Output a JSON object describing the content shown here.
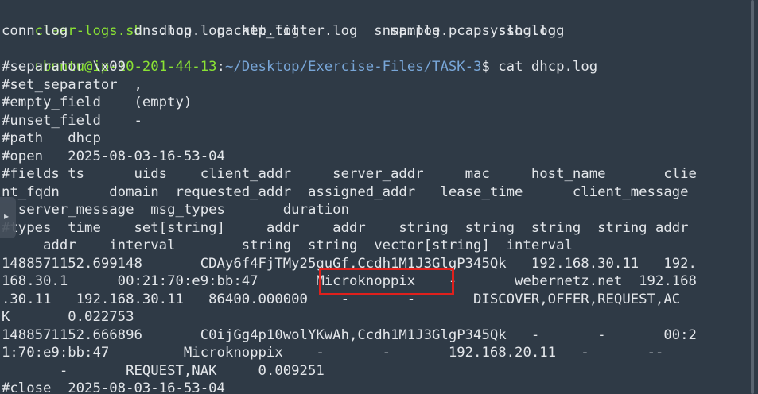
{
  "terminal": {
    "top_partial": "  ",
    "ls_row1": {
      "script": "clear-logs.sh",
      "rest": "  dhcp.log  ntp.log           sample.pcap  ssh.log"
    },
    "ls_row2": "conn.log        dns.log   packet_filter.log  snmp.log     syslog.log",
    "prompt": {
      "user_host": "ubuntu@ip-10-201-44-13",
      "colon": ":",
      "path": "~/Desktop/Exercise-Files/TASK-3",
      "symbol": "$",
      "command": " cat dhcp.log"
    },
    "output_lines": [
      "#separator \\x09",
      "#set_separator  ,",
      "#empty_field    (empty)",
      "#unset_field    -",
      "#path   dhcp",
      "#open   2025-08-03-16-53-04",
      "#fields ts      uids    client_addr     server_addr     mac     host_name       clie",
      "nt_fqdn      domain  requested_addr  assigned_addr   lease_time      client_message",
      "  server_message  msg_types       duration",
      "#types  time    set[string]     addr    addr    string  string  string  string addr",
      "     addr    interval        string  string  vector[string]  interval",
      "1488571152.699148       CDAy6f4FjTMy25guGf,Ccdh1M1J3GlgP345Qk   192.168.30.11   192.",
      "168.30.1      00:21:70:e9:bb:47       Microknoppix    -       webernetz.net  192.168",
      ".30.11   192.168.30.11   86400.000000    -       -       DISCOVER,OFFER,REQUEST,AC",
      "K       0.022753",
      "1488571152.666896       C0ijGg4p10wolYKwAh,Ccdh1M1J3GlgP345Qk   -       -       00:2",
      "1:70:e9:bb:47         Microknoppix    -       -       192.168.20.11   -       --",
      "       -       REQUEST,NAK     0.009251",
      "#close  2025-08-03-16-53-04"
    ],
    "side_handle_icon": "▸"
  }
}
